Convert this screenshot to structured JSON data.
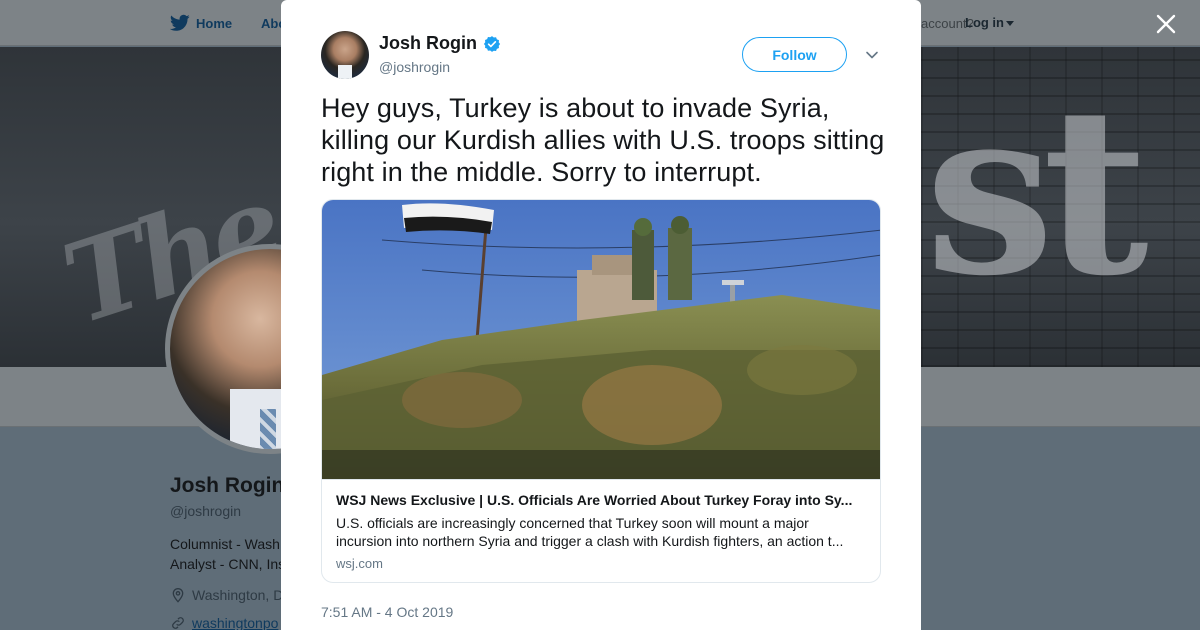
{
  "background_page": {
    "nav": {
      "home_label": "Home",
      "about_label": "Abo",
      "account_prompt": "account?",
      "login_label": "Log in"
    },
    "profile": {
      "name": "Josh Rogin",
      "handle": "@joshrogin",
      "bio_line1": "Columnist - Wash",
      "bio_line2": "Analyst - CNN, Ins",
      "location": "Washington, D",
      "website": "washingtonpo"
    }
  },
  "close_icon": "close-icon",
  "tweet": {
    "author": {
      "name": "Josh Rogin",
      "handle": "@joshrogin",
      "verified": true
    },
    "follow_label": "Follow",
    "text": "Hey guys, Turkey is about to invade Syria, killing our Kurdish allies with U.S. troops sitting right in the middle. Sorry to interrupt.",
    "card": {
      "title": "WSJ News Exclusive | U.S. Officials Are Worried About Turkey Foray into Sy...",
      "description_line1": "U.S. officials are increasingly concerned that Turkey soon will mount a major",
      "description_line2": "incursion into northern Syria and trigger a clash with Kurdish fighters, an action t...",
      "domain": "wsj.com"
    },
    "timestamp": "7:51 AM - 4 Oct 2019"
  },
  "colors": {
    "accent": "#1da1f2",
    "text_primary": "#14171a",
    "text_secondary": "#657786",
    "border": "#e1e8ed"
  }
}
